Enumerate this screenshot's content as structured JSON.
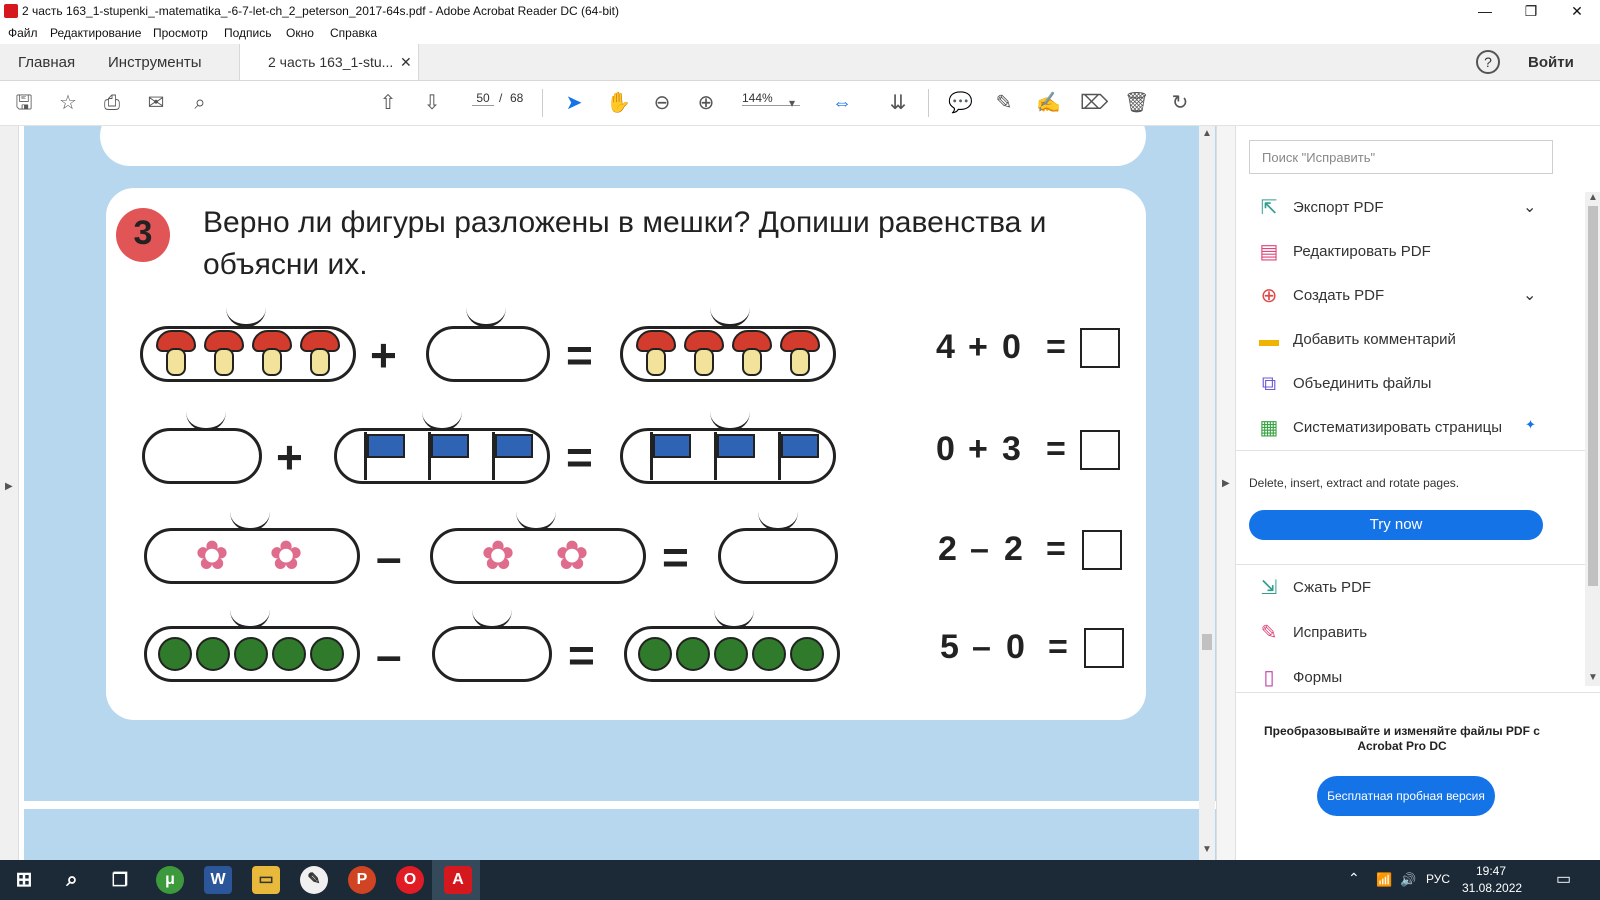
{
  "window": {
    "title": "2 часть 163_1-stupenki_-matematika_-6-7-let-ch_2_peterson_2017-64s.pdf - Adobe Acrobat Reader DC (64-bit)",
    "minimize": "—",
    "maximize": "❐",
    "close": "✕"
  },
  "menu": [
    "Файл",
    "Редактирование",
    "Просмотр",
    "Подпись",
    "Окно",
    "Справка"
  ],
  "tabs": {
    "home": "Главная",
    "tools": "Инструменты",
    "document": "2 часть 163_1-stu...",
    "close": "✕",
    "help": "?",
    "signin": "Войти"
  },
  "toolbar": {
    "page_current": "50",
    "page_sep": "/",
    "page_total": "68",
    "zoom": "144%"
  },
  "page": {
    "badge": "3",
    "task": "Верно ли фигуры разложены в мешки? Допиши равенства и объясни их.",
    "rows": [
      {
        "equation_left": "4",
        "op": "+",
        "equation_right": "0",
        "eq": "="
      },
      {
        "equation_left": "0",
        "op": "+",
        "equation_right": "3",
        "eq": "="
      },
      {
        "equation_left": "2",
        "op": "–",
        "equation_right": "2",
        "eq": "="
      },
      {
        "equation_left": "5",
        "op": "–",
        "equation_right": "0",
        "eq": "="
      }
    ],
    "sym_plus": "+",
    "sym_minus": "–",
    "sym_equals": "="
  },
  "right_panel": {
    "search_placeholder": "Поиск \"Исправить\"",
    "items": [
      {
        "label": "Экспорт PDF",
        "icon": "export-pdf-icon",
        "color": "#2f9e8f"
      },
      {
        "label": "Редактировать PDF",
        "icon": "edit-pdf-icon",
        "color": "#e0457b"
      },
      {
        "label": "Создать PDF",
        "icon": "create-pdf-icon",
        "color": "#e04646"
      },
      {
        "label": "Добавить комментарий",
        "icon": "comment-icon",
        "color": "#f0b400"
      },
      {
        "label": "Объединить файлы",
        "icon": "combine-icon",
        "color": "#6c5bd4"
      },
      {
        "label": "Систематизировать страницы",
        "icon": "organize-icon",
        "color": "#3aa345"
      }
    ],
    "organize_desc": "Delete, insert, extract and rotate pages.",
    "try_now": "Try now",
    "items2": [
      {
        "label": "Сжать PDF",
        "icon": "compress-icon",
        "color": "#2f9e8f"
      },
      {
        "label": "Исправить",
        "icon": "fix-icon",
        "color": "#e0457b"
      },
      {
        "label": "Формы",
        "icon": "forms-icon",
        "color": "#c042a8"
      }
    ],
    "promo": "Преобразовывайте и изменяйте файлы PDF с Acrobat Pro DC",
    "trial": "Бесплатная пробная версия"
  },
  "taskbar": {
    "lang": "РУС",
    "time": "19:47",
    "date": "31.08.2022"
  }
}
